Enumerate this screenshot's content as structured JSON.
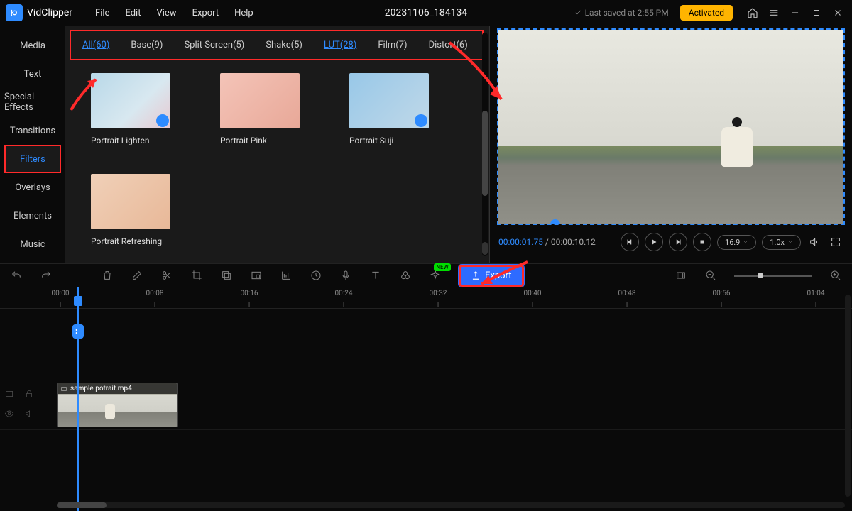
{
  "app": {
    "name": "VidClipper"
  },
  "menu": [
    "File",
    "Edit",
    "View",
    "Export",
    "Help"
  ],
  "project_title": "20231106_184134",
  "saved_text": "Last saved at 2:55 PM",
  "activated_label": "Activated",
  "sidebar": {
    "items": [
      "Media",
      "Text",
      "Special Effects",
      "Transitions",
      "Filters",
      "Overlays",
      "Elements",
      "Music"
    ],
    "active_index": 4
  },
  "filter_tabs": [
    {
      "label": "All(60)",
      "link": true
    },
    {
      "label": "Base(9)"
    },
    {
      "label": "Split Screen(5)"
    },
    {
      "label": "Shake(5)"
    },
    {
      "label": "LUT(28)",
      "link": true
    },
    {
      "label": "Film(7)"
    },
    {
      "label": "Distort(6)"
    }
  ],
  "thumbs": [
    {
      "label": "Portrait Lighten",
      "dl": true,
      "variant": "lighten"
    },
    {
      "label": "Portrait Pink",
      "dl": false,
      "variant": "pink"
    },
    {
      "label": "Portrait Suji",
      "dl": true,
      "variant": "suji"
    },
    {
      "label": "Portrait Refreshing",
      "dl": false,
      "variant": "refresh"
    }
  ],
  "preview": {
    "time_current": "00:00:01.75",
    "time_total": "00:00:10.12",
    "aspect": "16:9",
    "speed": "1.0x"
  },
  "export_label": "Export",
  "timeline": {
    "ticks": [
      "00:00",
      "00:08",
      "00:16",
      "00:24",
      "00:32",
      "00:40",
      "00:48",
      "00:56",
      "01:04"
    ],
    "clip_name": "sample potrait.mp4"
  }
}
